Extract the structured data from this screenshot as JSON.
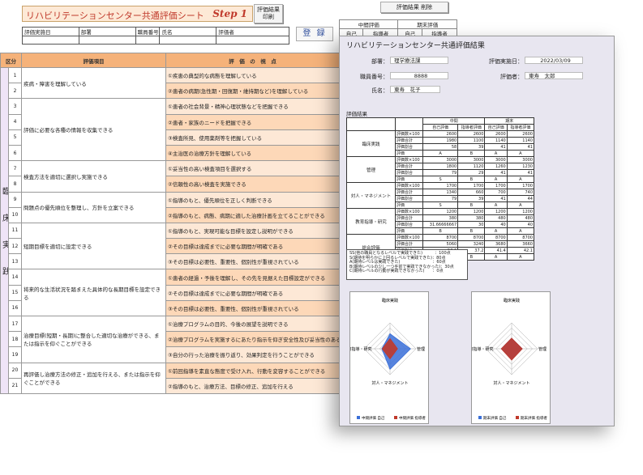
{
  "left_sheet": {
    "title": "リハビリテーションセンター共通評価シート",
    "step": "Step 1",
    "button_print": "評価結果\n印刷",
    "button_register": "登 録",
    "header_labels": [
      "評価実施日",
      "部署",
      "職員番号",
      "氏名",
      "評価者"
    ],
    "table_headers": {
      "kubun": "区分",
      "item": "評価項目",
      "viewpoint": "評　価　の　視　点"
    },
    "kubun_label": "臨床実践",
    "rows": [
      {
        "no": "1",
        "item": "疾病・障害を理解している",
        "vp": "①疾患の典型的な病態を理解している"
      },
      {
        "no": "2",
        "item": "",
        "vp": "②患者の病期(急性期・回復期・維持期など)を理解している"
      },
      {
        "no": "3",
        "item": "評価に必要な各種の情報を収集できる",
        "vp": "①患者の社会背景・精神心理状態などを把握できる"
      },
      {
        "no": "4",
        "item": "",
        "vp": "②患者・家族のニードを把握できる"
      },
      {
        "no": "5",
        "item": "",
        "vp": "③検査所見、使用薬剤等を把握している"
      },
      {
        "no": "6",
        "item": "",
        "vp": "④主治医の治療方針を理解している"
      },
      {
        "no": "7",
        "item": "検査方法を適切に選択し実施できる",
        "vp": "①妥当性の高い検査項目を選択する"
      },
      {
        "no": "8",
        "item": "",
        "vp": "②信頼性の高い検査を実施できる"
      },
      {
        "no": "9",
        "item": "問題点の優先順位を整理し、方針を立案できる",
        "vp": "①指導のもと、優先順位を正しく判断できる"
      },
      {
        "no": "10",
        "item": "",
        "vp": "②指導のもと、病態、病期に適した治療計画を立てることができる"
      },
      {
        "no": "11",
        "item": "短期目標を適切に設定できる",
        "vp": "①指導のもと、実現可能な目標を設定し説明ができる"
      },
      {
        "no": "12",
        "item": "",
        "vp": "②その目標は達成までに必要な期間が明確である"
      },
      {
        "no": "13",
        "item": "",
        "vp": "③その目標は必要性、重要性、個別性が重視されている"
      },
      {
        "no": "14",
        "item": "将来的な生活状況を踏まえた具体的な長期目標を設定できる",
        "vp": "①患者の経過・予後を理解し、その先を見据えた目標設定ができる"
      },
      {
        "no": "15",
        "item": "",
        "vp": "②その目標は達成までに必要な期間が明確である"
      },
      {
        "no": "16",
        "item": "",
        "vp": "③その目標は必要性、重要性、個別性が重視されている"
      },
      {
        "no": "17",
        "item": "治療目標(短期・長期)に整合した適切な治療ができる、または指示を仰ぐことができる",
        "vp": "①治療プログラムの目的、今後の展望を説明できる"
      },
      {
        "no": "18",
        "item": "",
        "vp": "②治療プログラムを実施するにあたり指示を仰ぎ安全性及び妥当性のある治療を行う事ができる"
      },
      {
        "no": "19",
        "item": "",
        "vp": "③自分の行った治療を振り返り、効果判定を行うことができる"
      },
      {
        "no": "20",
        "item": "再評価し治療方法の修正・追加を行える、または指示を仰ぐことができる",
        "vp": "①前回指導を素直な態度で受け入れ、行動を変容することができる"
      },
      {
        "no": "21",
        "item": "",
        "vp": "②指導のもと、治療方法、目標の修正、追加を行える"
      }
    ]
  },
  "top_right": {
    "delete_button": "評価結果 削除",
    "chukan": "中間評価",
    "kimatsu": "期末評価",
    "sub": [
      "自己",
      "指導者",
      "自己",
      "指導者"
    ]
  },
  "right_sheet": {
    "title": "リハビリテーションセンター共通評価結果",
    "labels": {
      "busho": "部署：",
      "date": "評価実施日：",
      "shokuin": "職員番号：",
      "hyokasha": "評価者：",
      "shimei": "氏名："
    },
    "values": {
      "busho": "理学療法課",
      "date": "2022/03/09",
      "shokuin": "8888",
      "hyokasha": "東寿　太郎",
      "shimei": "東寿　花子"
    },
    "result_label": "評価結果",
    "col_headers": {
      "mid": "中間",
      "end": "期末",
      "self": "自己評価",
      "sup": "指導者評価"
    },
    "categories": [
      {
        "name": "臨床実践",
        "rows": [
          [
            "評価数×100",
            "2600",
            "2600",
            "2600",
            "2600"
          ],
          [
            "評価合計",
            "1980",
            "1100",
            "1140",
            "1140"
          ],
          [
            "評価割合",
            "58",
            "39",
            "41",
            "41"
          ],
          [
            "評価",
            "A",
            "B",
            "A",
            "A"
          ]
        ]
      },
      {
        "name": "管理",
        "rows": [
          [
            "評価数×100",
            "3000",
            "3000",
            "3000",
            "3000"
          ],
          [
            "評価合計",
            "1800",
            "1120",
            "1260",
            "1230"
          ],
          [
            "評価割合",
            "79",
            "29",
            "41",
            "41"
          ],
          [
            "評価",
            "S",
            "B",
            "A",
            "A"
          ]
        ]
      },
      {
        "name": "対人・マネジメント",
        "rows": [
          [
            "評価数×100",
            "1700",
            "1700",
            "1700",
            "1700"
          ],
          [
            "評価合計",
            "1340",
            "660",
            "700",
            "740"
          ],
          [
            "評価割合",
            "79",
            "39",
            "41",
            "44"
          ],
          [
            "評価",
            "S",
            "B",
            "A",
            "A"
          ]
        ]
      },
      {
        "name": "教育指導・研究",
        "rows": [
          [
            "評価数×100",
            "1200",
            "1200",
            "1200",
            "1200"
          ],
          [
            "評価合計",
            "380",
            "380",
            "480",
            "480"
          ],
          [
            "評価割合",
            "31.66666667",
            "30",
            "40",
            "40"
          ],
          [
            "評価",
            "B",
            "B",
            "A",
            "A"
          ]
        ]
      },
      {
        "name": "総合評価",
        "rows": [
          [
            "評価数×100",
            "8700",
            "8700",
            "8700",
            "8700"
          ],
          [
            "評価合計",
            "5060",
            "3240",
            "3680",
            "3660"
          ],
          [
            "評価割合",
            "58.1",
            "37.2",
            "41.4",
            "42.1"
          ],
          [
            "評価",
            "A",
            "B",
            "A",
            "A"
          ]
        ]
      }
    ],
    "legend": [
      "SS(他の職員となるレベルで実践できた)　　　：100点",
      "S(期待を明らかに上回るレベルで実践できた)：80点",
      "A(期待レベルは実践できた)　　　　　　　　：60点",
      "B(期待レベルの少し一つ手前で実践できなかった)：30点",
      "C(期待レベルの行動が実践できなかった)　　：0点"
    ],
    "radar_axes": [
      "臨床実践",
      "管理",
      "対人・マネジメント",
      "教育指導・研究"
    ],
    "radar1_legend": [
      "中間評価 自己",
      "中間評価 指導者"
    ],
    "radar2_legend": [
      "期末評価 自己",
      "期末評価 指導者"
    ],
    "chart_data": [
      {
        "type": "radar",
        "axes": [
          "臨床実践",
          "管理",
          "対人・マネジメント",
          "教育指導・研究"
        ],
        "series": [
          {
            "name": "中間評価 自己",
            "values": [
              58,
              79,
              79,
              31.7
            ]
          },
          {
            "name": "中間評価 指導者",
            "values": [
              39,
              29,
              39,
              30
            ]
          }
        ],
        "ylim": [
          0,
          100
        ],
        "colors": [
          "#3a6fd8",
          "#c0392b"
        ]
      },
      {
        "type": "radar",
        "axes": [
          "臨床実践",
          "管理",
          "対人・マネジメント",
          "教育指導・研究"
        ],
        "series": [
          {
            "name": "期末評価 自己",
            "values": [
              41,
              41,
              41,
              40
            ]
          },
          {
            "name": "期末評価 指導者",
            "values": [
              41,
              41,
              44,
              40
            ]
          }
        ],
        "ylim": [
          0,
          100
        ],
        "colors": [
          "#3a6fd8",
          "#c0392b"
        ]
      }
    ]
  }
}
